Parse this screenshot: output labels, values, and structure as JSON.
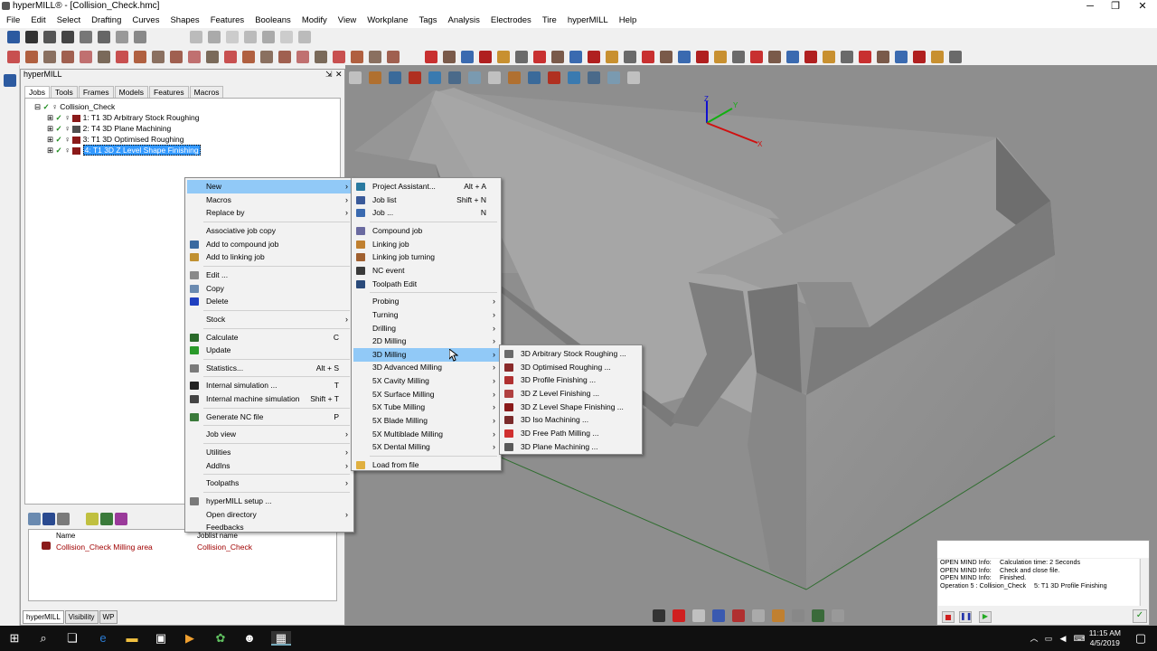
{
  "window": {
    "title": "hyperMILL® - [Collision_Check.hmc]"
  },
  "menubar": [
    "File",
    "Edit",
    "Select",
    "Drafting",
    "Curves",
    "Shapes",
    "Features",
    "Booleans",
    "Modify",
    "View",
    "Workplane",
    "Tags",
    "Analysis",
    "Electrodes",
    "Tire",
    "hyperMILL",
    "Help"
  ],
  "panel": {
    "title": "hyperMILL",
    "tabs": [
      "Jobs",
      "Tools",
      "Frames",
      "Models",
      "Features",
      "Macros"
    ],
    "tree_root": "Collision_Check",
    "tree_items": [
      "1: T1 3D Arbitrary Stock Roughing",
      "2: T4 3D Plane Machining",
      "3: T1 3D Optimised Roughing",
      "4: T1 3D Z Level Shape Finishing"
    ],
    "list_headers": [
      "Name",
      "Joblist name"
    ],
    "list_row": [
      "Collision_Check Milling area",
      "Collision_Check"
    ],
    "bottom_tabs": [
      "hyperMILL",
      "Visibility",
      "WP"
    ]
  },
  "menu1": {
    "items": [
      {
        "label": "New",
        "shortcut": "",
        "arrow": "›",
        "hl": true
      },
      {
        "label": "Macros",
        "shortcut": "",
        "arrow": "›"
      },
      {
        "label": "Replace by",
        "shortcut": "",
        "arrow": "›"
      },
      {
        "sep": true
      },
      {
        "label": "Associative job copy",
        "shortcut": ""
      },
      {
        "label": "Add to compound job",
        "shortcut": ""
      },
      {
        "label": "Add to linking job",
        "shortcut": ""
      },
      {
        "sep": true
      },
      {
        "label": "Edit ...",
        "shortcut": ""
      },
      {
        "label": "Copy",
        "shortcut": ""
      },
      {
        "label": "Delete",
        "shortcut": ""
      },
      {
        "sep": true
      },
      {
        "label": "Stock",
        "shortcut": "",
        "arrow": "›"
      },
      {
        "sep": true
      },
      {
        "label": "Calculate",
        "shortcut": "C"
      },
      {
        "label": "Update",
        "shortcut": ""
      },
      {
        "sep": true
      },
      {
        "label": "Statistics...",
        "shortcut": "Alt + S"
      },
      {
        "sep": true
      },
      {
        "label": "Internal simulation ...",
        "shortcut": "T"
      },
      {
        "label": "Internal machine simulation",
        "shortcut": "Shift + T"
      },
      {
        "sep": true
      },
      {
        "label": "Generate NC file",
        "shortcut": "P"
      },
      {
        "sep": true
      },
      {
        "label": "Job view",
        "shortcut": "",
        "arrow": "›"
      },
      {
        "sep": true
      },
      {
        "label": "Utilities",
        "shortcut": "",
        "arrow": "›"
      },
      {
        "label": "AddIns",
        "shortcut": "",
        "arrow": "›"
      },
      {
        "sep": true
      },
      {
        "label": "Toolpaths",
        "shortcut": "",
        "arrow": "›"
      },
      {
        "sep": true
      },
      {
        "label": "hyperMILL setup ...",
        "shortcut": ""
      },
      {
        "label": "Open directory",
        "shortcut": "",
        "arrow": "›"
      },
      {
        "label": "Feedbacks",
        "shortcut": ""
      }
    ]
  },
  "menu2": {
    "items": [
      {
        "label": "Project Assistant...",
        "shortcut": "Alt + A"
      },
      {
        "label": "Job list",
        "shortcut": "Shift + N"
      },
      {
        "label": "Job ...",
        "shortcut": "N"
      },
      {
        "sep": true
      },
      {
        "label": "Compound job",
        "shortcut": ""
      },
      {
        "label": "Linking job",
        "shortcut": ""
      },
      {
        "label": "Linking job turning",
        "shortcut": ""
      },
      {
        "label": "NC event",
        "shortcut": ""
      },
      {
        "label": "Toolpath Edit",
        "shortcut": ""
      },
      {
        "sep": true
      },
      {
        "label": "Probing",
        "shortcut": "",
        "arrow": "›"
      },
      {
        "label": "Turning",
        "shortcut": "",
        "arrow": "›"
      },
      {
        "label": "Drilling",
        "shortcut": "",
        "arrow": "›"
      },
      {
        "label": "2D Milling",
        "shortcut": "",
        "arrow": "›"
      },
      {
        "label": "3D Milling",
        "shortcut": "",
        "arrow": "›",
        "hl": true
      },
      {
        "label": "3D Advanced Milling",
        "shortcut": "",
        "arrow": "›"
      },
      {
        "label": "5X Cavity Milling",
        "shortcut": "",
        "arrow": "›"
      },
      {
        "label": "5X Surface Milling",
        "shortcut": "",
        "arrow": "›"
      },
      {
        "label": "5X Tube Milling",
        "shortcut": "",
        "arrow": "›"
      },
      {
        "label": "5X Blade Milling",
        "shortcut": "",
        "arrow": "›"
      },
      {
        "label": "5X Multiblade Milling",
        "shortcut": "",
        "arrow": "›"
      },
      {
        "label": "5X Dental Milling",
        "shortcut": "",
        "arrow": "›"
      },
      {
        "sep": true
      },
      {
        "label": "Load from file",
        "shortcut": ""
      }
    ]
  },
  "menu3": {
    "items": [
      {
        "label": "3D Arbitrary Stock Roughing ..."
      },
      {
        "label": "3D Optimised Roughing ..."
      },
      {
        "label": "3D Profile Finishing ..."
      },
      {
        "label": "3D Z Level Finishing ..."
      },
      {
        "label": "3D Z Level Shape Finishing ..."
      },
      {
        "label": "3D Iso Machining ..."
      },
      {
        "label": "3D Free Path Milling ..."
      },
      {
        "label": "3D Plane Machining ..."
      }
    ]
  },
  "log": {
    "lines": [
      [
        "OPEN MIND Info:",
        "Calculation time: 2 Seconds"
      ],
      [
        "OPEN MIND Info:",
        "Check and close file."
      ],
      [
        "OPEN MIND Info:",
        "Finished."
      ],
      [
        "Operation 5 : Collision_Check",
        "5: T1 3D Profile Finishing"
      ]
    ]
  },
  "axes": {
    "x": "X",
    "y": "Y",
    "z": "Z"
  },
  "clock": {
    "time": "11:15 AM",
    "date": "4/5/2019"
  },
  "colors": {
    "menu_highlight": "#91c9f7",
    "selection": "#3399ff",
    "viewport_bg": "#8e8e8e"
  }
}
